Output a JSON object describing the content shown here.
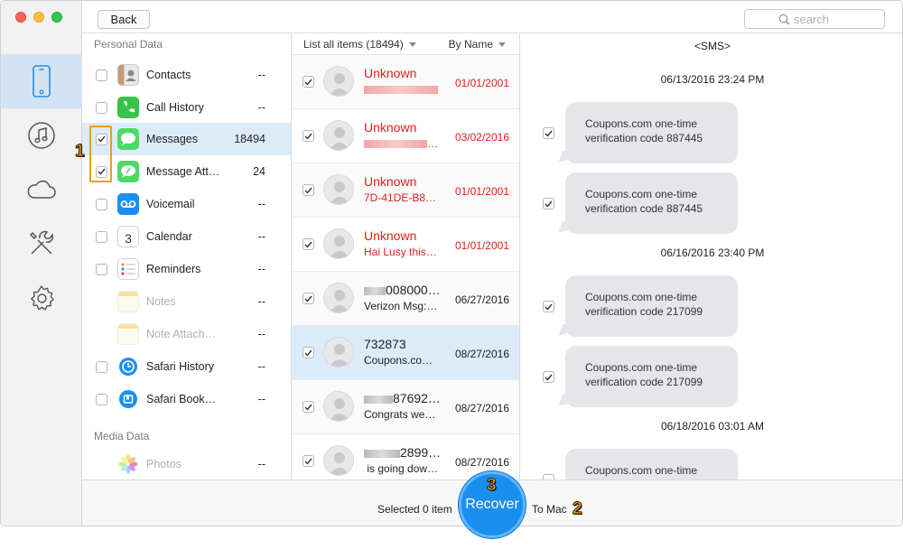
{
  "window": {
    "back_label": "Back",
    "search_placeholder": "search"
  },
  "sidebar_nav": [
    {
      "icon": "iphone-icon",
      "active": true
    },
    {
      "icon": "music-icon",
      "active": false
    },
    {
      "icon": "cloud-icon",
      "active": false
    },
    {
      "icon": "tools-icon",
      "active": false
    },
    {
      "icon": "gear-icon",
      "active": false
    }
  ],
  "categories": {
    "personal_header": "Personal Data",
    "media_header": "Media Data",
    "items": [
      {
        "label": "Contacts",
        "count": "--",
        "checked": false,
        "icon": "contacts-icon"
      },
      {
        "label": "Call History",
        "count": "--",
        "checked": false,
        "icon": "phone-icon"
      },
      {
        "label": "Messages",
        "count": "18494",
        "checked": true,
        "icon": "messages-icon",
        "active": true
      },
      {
        "label": "Message Att…",
        "count": "24",
        "checked": true,
        "icon": "message-attachment-icon"
      },
      {
        "label": "Voicemail",
        "count": "--",
        "checked": false,
        "icon": "voicemail-icon"
      },
      {
        "label": "Calendar",
        "count": "--",
        "checked": false,
        "icon": "calendar-icon"
      },
      {
        "label": "Reminders",
        "count": "--",
        "checked": false,
        "icon": "reminders-icon"
      },
      {
        "label": "Notes",
        "count": "--",
        "checked": false,
        "icon": "notes-icon",
        "disabled": true
      },
      {
        "label": "Note Attach…",
        "count": "--",
        "checked": false,
        "icon": "note-attachment-icon",
        "disabled": true
      },
      {
        "label": "Safari History",
        "count": "--",
        "checked": false,
        "icon": "safari-history-icon"
      },
      {
        "label": "Safari Book…",
        "count": "--",
        "checked": false,
        "icon": "safari-bookmark-icon"
      },
      {
        "label": "Photos",
        "count": "--",
        "checked": false,
        "icon": "photos-icon",
        "disabled": true
      }
    ],
    "calendar_day": "3"
  },
  "list": {
    "header_left": "List all items (18494)",
    "header_right": "By Name",
    "rows": [
      {
        "name": "Unknown",
        "preview": "",
        "date": "01/01/2001",
        "red": true
      },
      {
        "name": "Unknown",
        "preview": "…",
        "date": "03/02/2016",
        "red": true
      },
      {
        "name": "Unknown",
        "preview": "7D-41DE-B8…",
        "date": "01/01/2001",
        "red": true
      },
      {
        "name": "Unknown",
        "preview": "Hai Lusy this…",
        "date": "01/01/2001",
        "red": true
      },
      {
        "name": "008000…",
        "preview": "Verizon Msg:…",
        "date": "06/27/2016",
        "red": false
      },
      {
        "name": "732873",
        "preview": "Coupons.co…",
        "date": "08/27/2016",
        "red": false,
        "selected": true
      },
      {
        "name": "87692…",
        "preview": "Congrats we…",
        "date": "08/27/2016",
        "red": false
      },
      {
        "name": "2899…",
        "preview": "is going dow…",
        "date": "08/27/2016",
        "red": false
      }
    ]
  },
  "detail": {
    "header": "<SMS>",
    "timestamps": [
      "06/13/2016 23:24 PM",
      "06/16/2016 23:40 PM",
      "06/18/2016 03:01 AM"
    ],
    "messages": [
      "Coupons.com one-time verification code 887445",
      "Coupons.com one-time verification code 887445",
      "Coupons.com one-time verification code 217099",
      "Coupons.com one-time verification code 217099",
      "Coupons.com one-time"
    ]
  },
  "bottom": {
    "selected_text": "Selected 0 item",
    "recover_label": "Recover",
    "destination": "To Mac"
  },
  "annotations": {
    "step1": "1",
    "step2": "2",
    "step3": "3"
  }
}
